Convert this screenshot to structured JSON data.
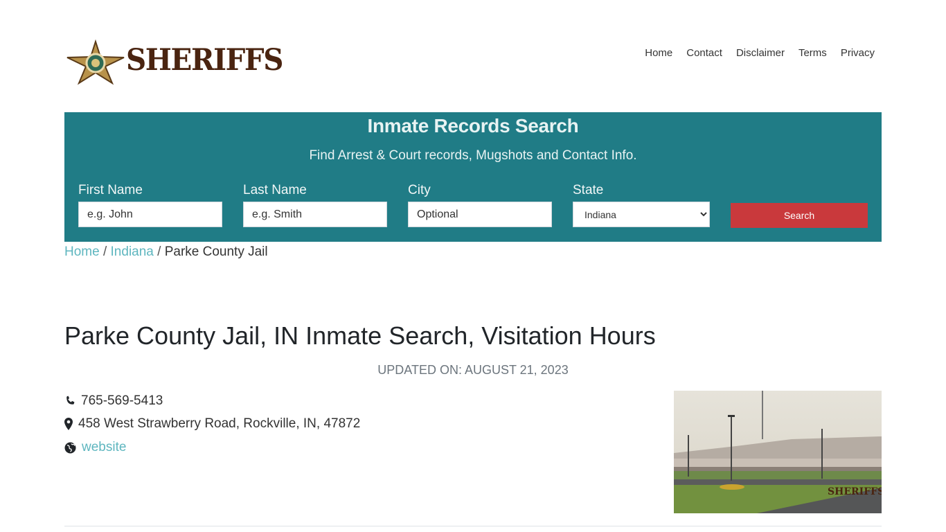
{
  "header": {
    "logo_text": "SHERIFFS",
    "nav": [
      "Home",
      "Contact",
      "Disclaimer",
      "Terms",
      "Privacy"
    ]
  },
  "search": {
    "title": "Inmate Records Search",
    "subtitle": "Find Arrest & Court records, Mugshots and Contact Info.",
    "first_name": {
      "label": "First Name",
      "placeholder": "e.g. John"
    },
    "last_name": {
      "label": "Last Name",
      "placeholder": "e.g. Smith"
    },
    "city": {
      "label": "City",
      "placeholder": "Optional"
    },
    "state": {
      "label": "State",
      "selected": "Indiana"
    },
    "button_label": "Search"
  },
  "breadcrumb": {
    "home": "Home",
    "state": "Indiana",
    "current": "Parke County Jail"
  },
  "page": {
    "title": "Parke County Jail, IN Inmate Search, Visitation Hours",
    "updated": "UPDATED ON: AUGUST 21, 2023",
    "phone": "765-569-5413",
    "address": "458 West Strawberry Road, Rockville, IN, 47872",
    "website_label": "website"
  },
  "icons": {
    "phone": "phone-icon",
    "location": "map-marker-icon",
    "website": "globe-icon"
  },
  "colors": {
    "panel": "#207c86",
    "button": "#c9393c",
    "link": "#5eb6bf",
    "logo": "#4a2410"
  }
}
